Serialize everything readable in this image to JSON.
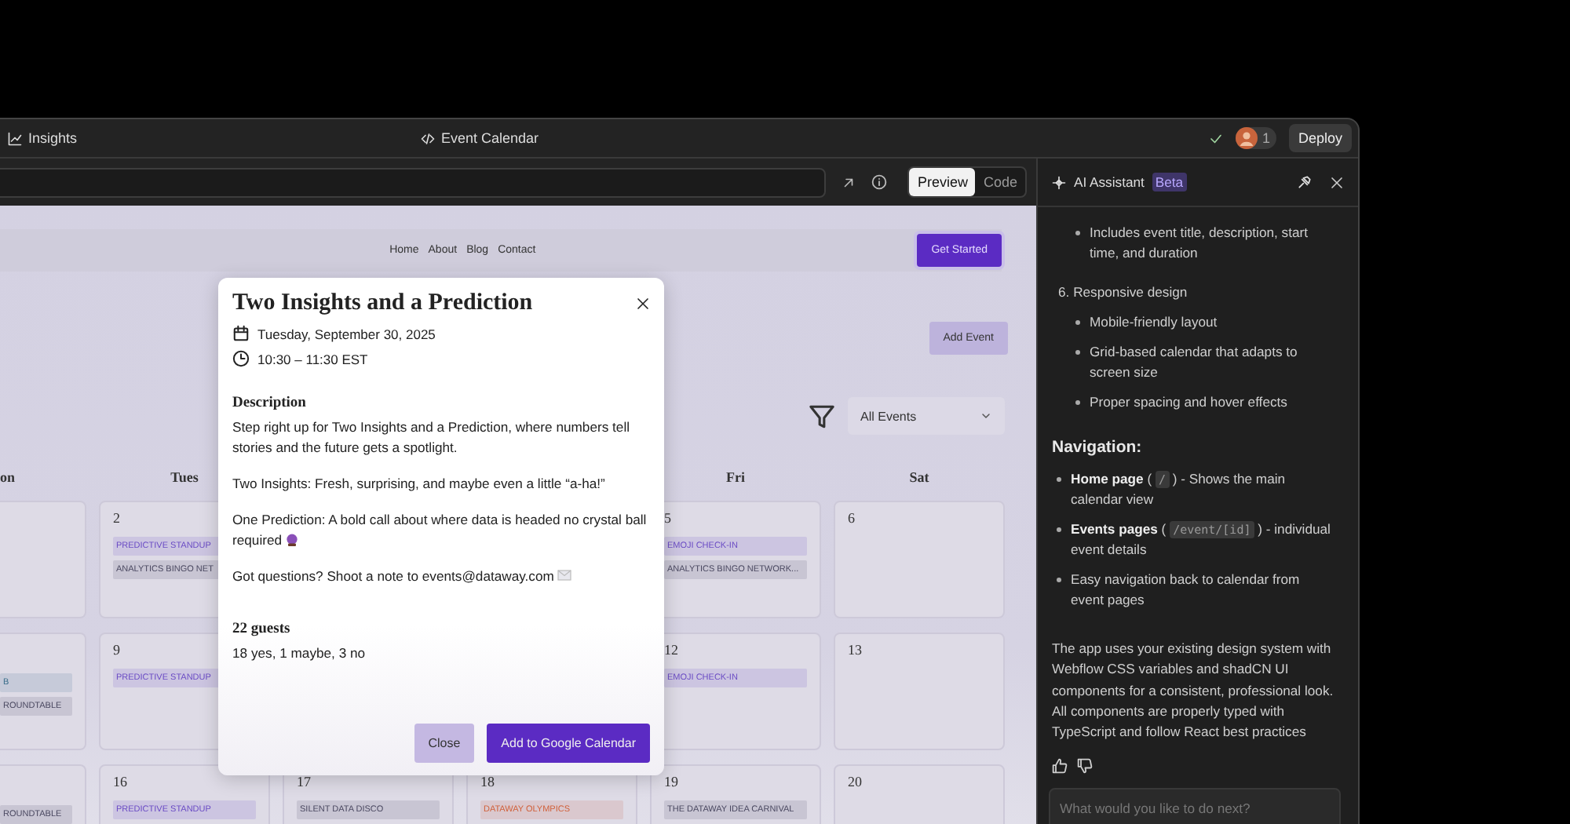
{
  "topbar": {
    "tab": "Insights",
    "title": "Event Calendar",
    "collaborators": "1",
    "deploy": "Deploy"
  },
  "toolbar": {
    "view_toggle": [
      {
        "label": "Preview",
        "selected": true
      },
      {
        "label": "Code",
        "selected": false
      }
    ]
  },
  "site": {
    "nav": [
      "Home",
      "About",
      "Blog",
      "Contact"
    ],
    "cta": "Get Started",
    "add_event": "Add Event",
    "filter": {
      "value": "All Events"
    },
    "headers": {
      "mon": "on",
      "tue": "Tues",
      "fri": "Fri",
      "sat": "Sat"
    },
    "weeks": [
      {
        "tue": {
          "date": "2",
          "events": [
            {
              "title": "PREDICTIVE STANDUP",
              "color": "#6a4bc4"
            },
            {
              "title": "ANALYTICS BINGO NET",
              "color": "#4a4860"
            }
          ]
        },
        "fri": {
          "date": "5",
          "events": [
            {
              "title": "EMOJI CHECK-IN",
              "color": "#6a4bc4"
            },
            {
              "title": "ANALYTICS BINGO NETWORK...",
              "color": "#4a4860"
            }
          ]
        },
        "sat": {
          "date": "6"
        }
      },
      {
        "mon": {
          "events": [
            {
              "title": "B",
              "color": "#3d6f8c"
            },
            {
              "title": "ROUNDTABLE",
              "color": "#4a4860"
            }
          ]
        },
        "tue": {
          "date": "9",
          "events": [
            {
              "title": "PREDICTIVE STANDUP",
              "color": "#6a4bc4"
            }
          ]
        },
        "fri": {
          "date": "12",
          "events": [
            {
              "title": "EMOJI CHECK-IN",
              "color": "#6a4bc4"
            }
          ]
        },
        "sat": {
          "date": "13"
        }
      },
      {
        "mon": {
          "events": [
            {
              "title": "ROUNDTABLE",
              "color": "#4a4860"
            }
          ]
        },
        "tue": {
          "date": "16",
          "events": [
            {
              "title": "PREDICTIVE STANDUP",
              "color": "#6a4bc4"
            }
          ]
        },
        "wed": {
          "date": "17",
          "events": [
            {
              "title": "SILENT DATA DISCO",
              "color": "#4a4860"
            }
          ]
        },
        "thu": {
          "date": "18",
          "events": [
            {
              "title": "DATAWAY OLYMPICS",
              "color": "#d0603a"
            }
          ]
        },
        "fri": {
          "date": "19",
          "events": [
            {
              "title": "THE DATAWAY IDEA CARNIVAL",
              "color": "#4a4860"
            }
          ]
        },
        "sat": {
          "date": "20"
        }
      }
    ]
  },
  "modal": {
    "title": "Two Insights and a Prediction",
    "date": "Tuesday, September 30, 2025",
    "time": "10:30 – 11:30 EST",
    "description_heading": "Description",
    "paragraphs": [
      {
        "text": "Step right up for Two Insights and a Prediction, where numbers tell stories and the future gets a spotlight.",
        "kind": "plain"
      },
      {
        "text": "Two Insights: Fresh, surprising, and maybe even a little “a-ha!”",
        "kind": "plain"
      },
      {
        "text": "One Prediction: A bold call about where data is headed no crystal ball required",
        "kind": "crystal"
      },
      {
        "text": "Got questions? Shoot a note to events@dataway.com",
        "kind": "mail"
      }
    ],
    "guests_heading": "22 guests",
    "guests_summary": "18 yes, 1 maybe, 3 no",
    "close": "Close",
    "add": "Add to Google Calendar"
  },
  "assistant": {
    "title": "AI Assistant",
    "badge": "Beta",
    "sections": [
      {
        "kind": "bullets",
        "items": [
          "Includes event title, description, start time, and duration"
        ]
      },
      {
        "kind": "numbered",
        "number": "6.",
        "text": "Responsive design",
        "items": [
          "Mobile-friendly layout",
          "Grid-based calendar that adapts to screen size",
          "Proper spacing and hover effects"
        ]
      },
      {
        "kind": "heading",
        "text": "Navigation:"
      },
      {
        "kind": "links",
        "items": [
          {
            "label": "Home page",
            "open": "(",
            "code": "/",
            "rest": ") - Shows the main calendar view"
          },
          {
            "label": "Events pages",
            "open": "(",
            "code": "/event/[id]",
            "rest": ") - individual event details"
          },
          {
            "text": "Easy navigation back to calendar from event pages"
          }
        ]
      },
      {
        "kind": "paragraph",
        "text": "The app uses your existing design system with Webflow CSS variables and shadCN UI components for a consistent, professional look. All components are properly typed with TypeScript and follow React best practices"
      }
    ],
    "input": {
      "placeholder": "What would you like to do next?"
    }
  }
}
